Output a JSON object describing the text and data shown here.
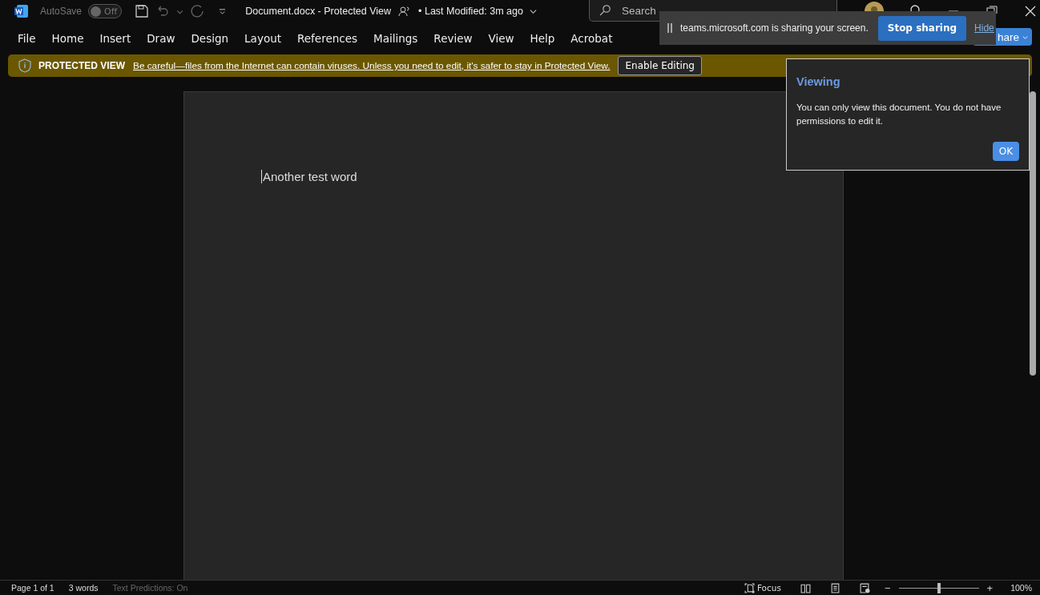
{
  "title_bar": {
    "autosave_label": "AutoSave",
    "autosave": {
      "on": false,
      "label": "Off"
    },
    "document_title": "Document.docx  -  Protected View",
    "modified": "• Last Modified: 3m ago",
    "search": {
      "placeholder": "Search"
    }
  },
  "ribbon_tabs": [
    "File",
    "Home",
    "Insert",
    "Draw",
    "Design",
    "Layout",
    "References",
    "Mailings",
    "Review",
    "View",
    "Help",
    "Acrobat"
  ],
  "share_button": {
    "label": "hare"
  },
  "protected_bar": {
    "title": "PROTECTED VIEW",
    "message": "Be careful—files from the Internet can contain viruses. Unless you need to edit, it's safer to stay in Protected View.",
    "button": "Enable Editing"
  },
  "document": {
    "text": "Another test word"
  },
  "sharing_toast": {
    "message": "teams.microsoft.com is sharing your screen.",
    "stop_button": "Stop sharing",
    "hide_link": "Hide"
  },
  "viewing_popup": {
    "title": "Viewing",
    "message": "You can only view this document. You do not have permissions to edit it.",
    "button": "OK"
  },
  "status_bar": {
    "page": "Page 1 of 1",
    "words": "3 words",
    "predictions": "Text Predictions: On",
    "focus": "Focus",
    "zoom": {
      "level": 0.5,
      "reading": "100%"
    },
    "zoom_out": "−",
    "zoom_in": "+"
  }
}
